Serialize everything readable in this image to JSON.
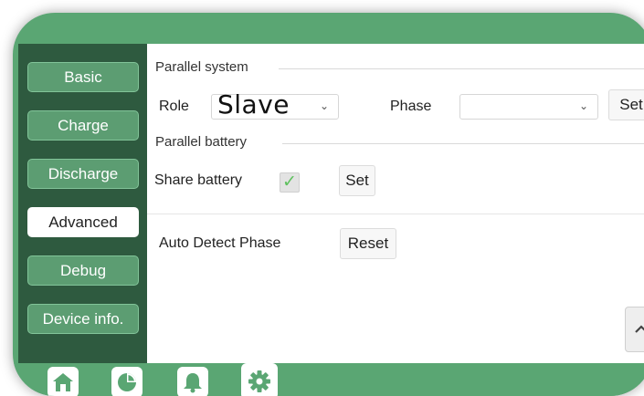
{
  "sidebar": {
    "items": [
      {
        "label": "Basic",
        "active": false
      },
      {
        "label": "Charge",
        "active": false
      },
      {
        "label": "Discharge",
        "active": false
      },
      {
        "label": "Advanced",
        "active": true
      },
      {
        "label": "Debug",
        "active": false
      },
      {
        "label": "Device info.",
        "active": false
      }
    ]
  },
  "parallel_system": {
    "title": "Parallel system",
    "role_label": "Role",
    "role_value": "Slave",
    "phase_label": "Phase",
    "phase_value": "",
    "set_label": "Set"
  },
  "parallel_battery": {
    "title": "Parallel battery",
    "share_label": "Share battery",
    "share_checked": true,
    "set_label": "Set"
  },
  "auto_detect": {
    "label": "Auto Detect Phase",
    "reset_label": "Reset"
  },
  "bottom_tabs": [
    {
      "icon": "home-icon"
    },
    {
      "icon": "chart-icon"
    },
    {
      "icon": "bell-icon"
    },
    {
      "icon": "gear-icon",
      "active": true
    }
  ],
  "colors": {
    "bezel": "#5aa673",
    "sidebar": "#2e5a3f",
    "nav_button": "#5c9d72",
    "check": "#5fc15f"
  }
}
